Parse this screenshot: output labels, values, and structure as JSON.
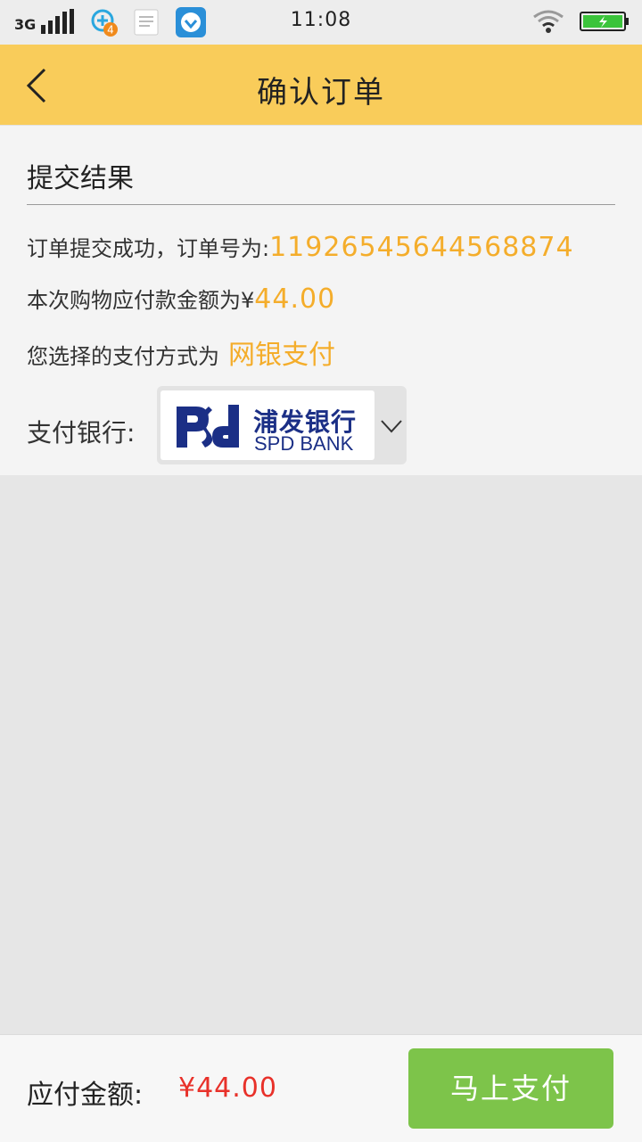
{
  "status_bar": {
    "network": "3G",
    "notification_count": "4",
    "time": "11:08"
  },
  "header": {
    "title": "确认订单"
  },
  "result": {
    "section_title": "提交结果",
    "order_prefix": "订单提交成功，订单号为:",
    "order_number": "11926545644568874",
    "amount_prefix": "本次购物应付款金额为¥",
    "amount": "44.00",
    "method_prefix": "您选择的支付方式为",
    "method": "网银支付"
  },
  "bank": {
    "label": "支付银行:",
    "selected_name_cn": "浦发银行",
    "selected_name_en": "SPD BANK"
  },
  "footer": {
    "due_label": "应付金额:",
    "due_amount": "¥44.00",
    "pay_button": "马上支付"
  },
  "colors": {
    "header_bg": "#f9cc5a",
    "highlight": "#f4ad2b",
    "price_red": "#e8312a",
    "pay_green": "#7dc44a",
    "bank_blue": "#1b2f86"
  }
}
